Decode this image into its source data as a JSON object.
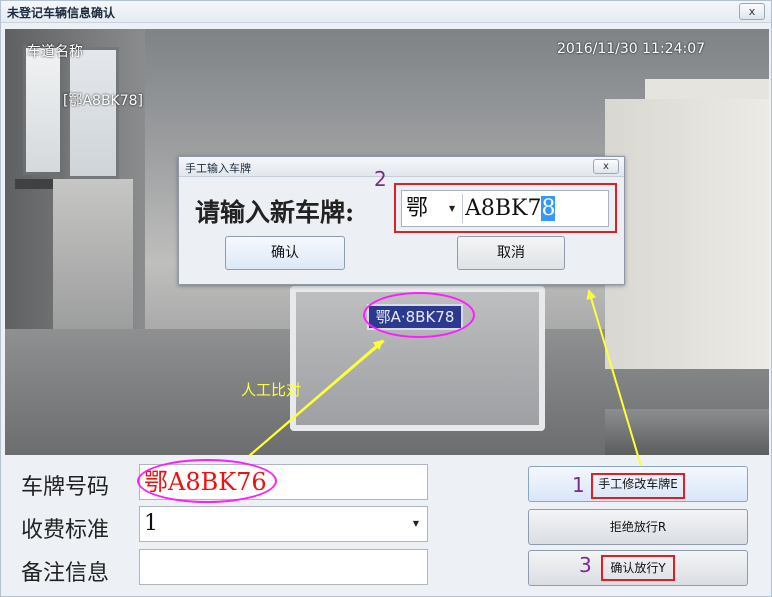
{
  "window": {
    "title": "未登记车辆信息确认",
    "close_glyph": "x"
  },
  "camera": {
    "lane_name": "车道名称",
    "timestamp": "2016/11/30  11:24:07",
    "recognized_plate_overlay": "[鄂A8BK78]",
    "plate_in_image": "鄂A·8BK78",
    "compare_note": "人工比对"
  },
  "dialog": {
    "title": "手工输入车牌",
    "close_glyph": "x",
    "prompt": "请输入新车牌:",
    "province": "鄂",
    "plate_text_main": "A8BK7",
    "plate_text_selected": "8",
    "ok_label": "确认",
    "cancel_label": "取消",
    "step_number": "2"
  },
  "form": {
    "plate_label": "车牌号码",
    "plate_value": "鄂A8BK76",
    "fee_label": "收费标准",
    "fee_value": "1",
    "note_label": "备注信息",
    "note_value": ""
  },
  "buttons": {
    "edit_label": "手工修改车牌E",
    "reject_label": "拒绝放行R",
    "confirm_label": "确认放行Y",
    "step_1": "1",
    "step_3": "3"
  },
  "colors": {
    "annotation_red": "#e02020",
    "ellipse_magenta": "#ff1cff",
    "arrow_yellow": "#ffff38",
    "step_number_purple": "#7a2a8e"
  },
  "icons": {
    "window_close": "close-icon",
    "dialog_close": "close-icon",
    "dropdown": "chevron-down-icon"
  }
}
